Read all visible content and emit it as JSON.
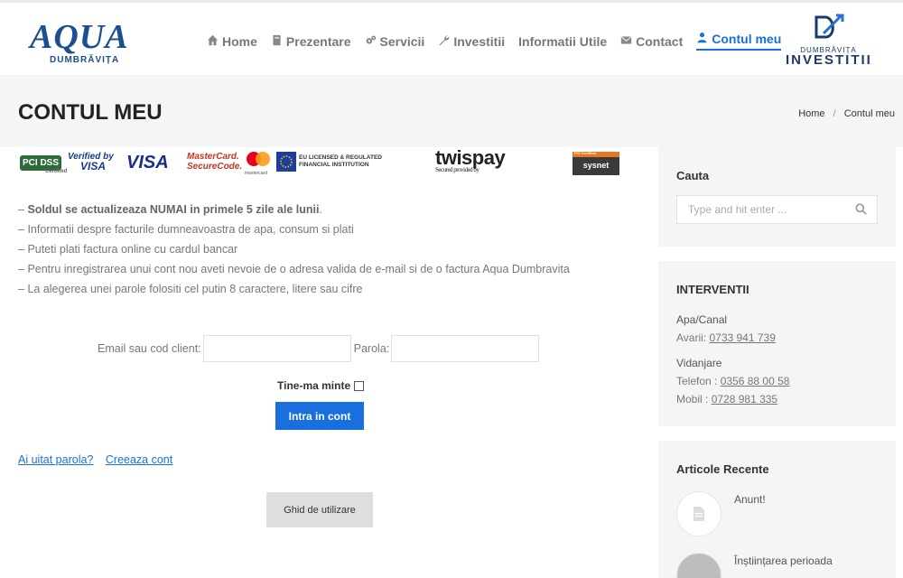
{
  "brand": {
    "logo_text": "AQUA",
    "logo_sub": "DUMBRĂVIȚA",
    "partner_small": "DUMBRĂVIȚA",
    "partner_big": "INVESTITII"
  },
  "nav": {
    "items": [
      {
        "label": "Home",
        "icon": "home-icon"
      },
      {
        "label": "Prezentare",
        "icon": "book-icon"
      },
      {
        "label": "Servicii",
        "icon": "cogs-icon"
      },
      {
        "label": "Investitii",
        "icon": "wrench-icon"
      },
      {
        "label": "Informatii Utile",
        "icon": ""
      },
      {
        "label": "Contact",
        "icon": "envelope-icon"
      },
      {
        "label": "Contul meu",
        "icon": "user-icon",
        "active": true
      }
    ]
  },
  "page": {
    "title": "CONTUL MEU",
    "breadcrumb": [
      "Home",
      "Contul meu"
    ]
  },
  "payments": {
    "pci": "PCI DSS",
    "pci_sub": "Certified",
    "verified_top": "Verified by",
    "verified_bottom": "VISA",
    "visa": "VISA",
    "mastercard_top": "MasterCard.",
    "mastercard_bottom": "SecureCode.",
    "mastercard_small": "mastercard",
    "eu_top": "EU LICENSED & REGULATED",
    "eu_bottom": "FINANCIAL INSTITUTION",
    "twispay": "twispay",
    "twispay_sub": "Secured provided by",
    "sysnet_top": "PCI Certified",
    "sysnet": "sysnet"
  },
  "info": {
    "bold_line": "Soldul se actualizeaza NUMAI in primele 5 zile ale lunii",
    "lines": [
      "Informatii despre facturile dumneavoastra de apa, consum si plati",
      "Puteti plati factura online cu cardul bancar",
      "Pentru inregistrarea unui cont nou aveti nevoie de o adresa valida de e-mail si de o factura Aqua Dumbravita",
      "La alegerea unei parole folositi cel putin 8 caractere, litere sau cifre"
    ]
  },
  "login": {
    "email_label": "Email sau cod client:",
    "password_label": "Parola:",
    "remember_label": "Tine-ma minte",
    "submit_label": "Intra in cont",
    "forgot_link": "Ai uitat parola?",
    "create_link": "Creeaza cont",
    "guide_button": "Ghid de utilizare"
  },
  "sidebar": {
    "search": {
      "title": "Cauta",
      "placeholder": "Type and hit enter ..."
    },
    "interventii": {
      "title": "INTERVENTII",
      "apa_label": "Apa/Canal",
      "avarii_prefix": "Avarii: ",
      "avarii_phone": "0733 941 739",
      "vid_label": "Vidanjare",
      "tel_prefix": "Telefon : ",
      "tel_phone": "0356 88 00 58",
      "mob_prefix": "Mobil : ",
      "mob_phone": "0728 981 335"
    },
    "recent": {
      "title": "Articole Recente",
      "items": [
        {
          "title": "Anunt!"
        },
        {
          "title": "Înștiințarea perioada"
        }
      ]
    }
  },
  "colors": {
    "accent": "#1a6fdf",
    "brand": "#1b4f8f",
    "panel": "#f5f5f5"
  }
}
